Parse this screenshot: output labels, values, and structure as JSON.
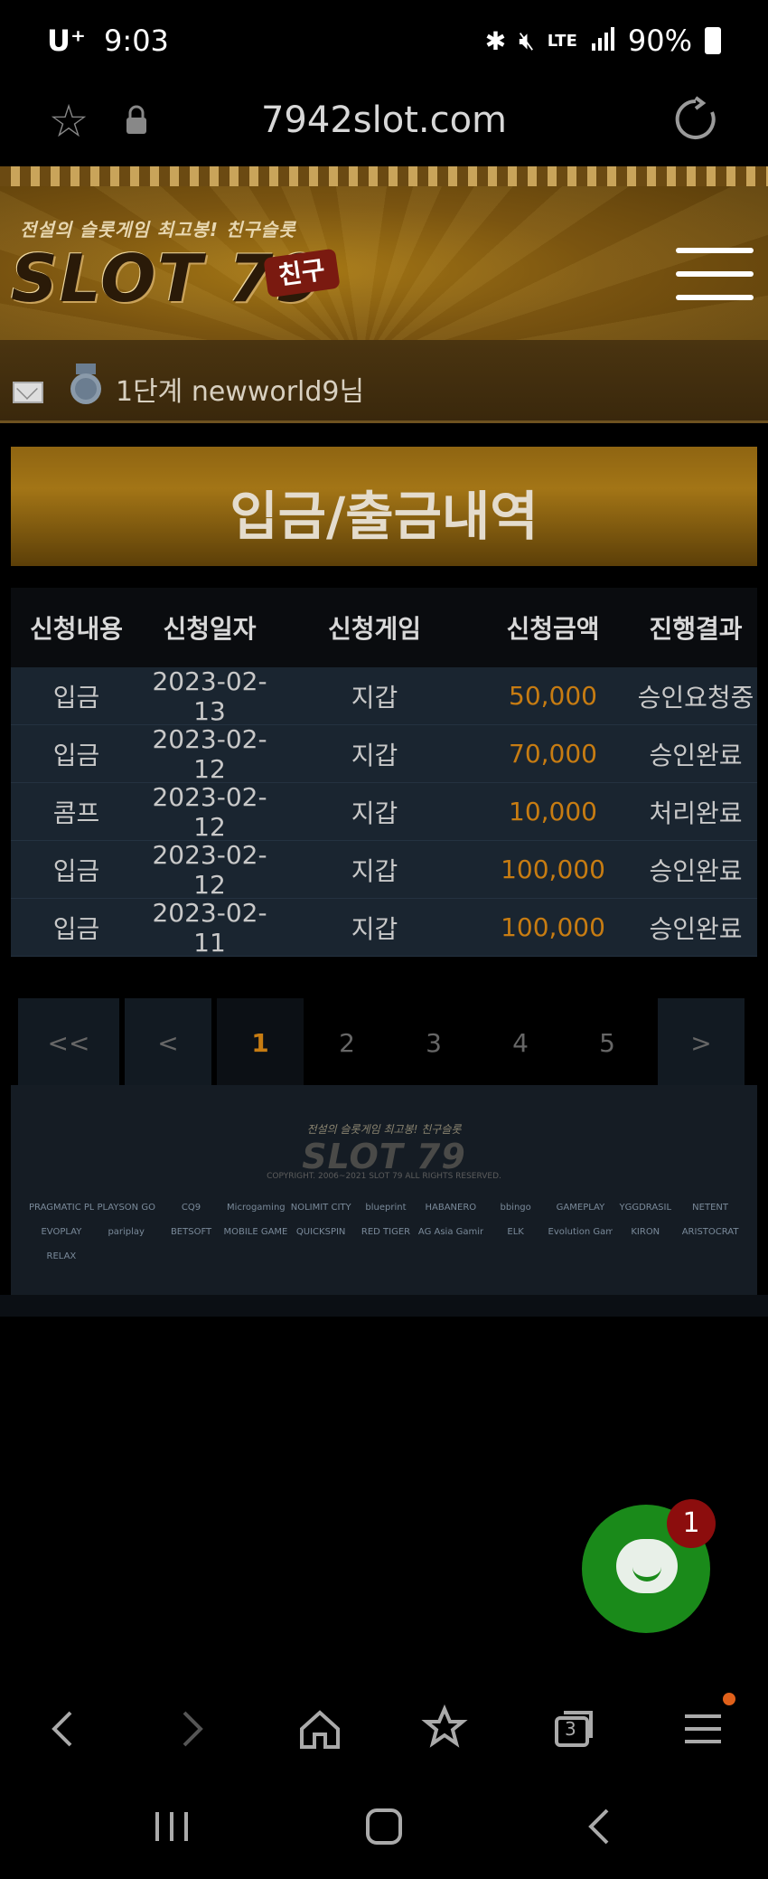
{
  "status_bar": {
    "carrier": "U⁺",
    "time": "9:03",
    "network": "LTE",
    "battery": "90%"
  },
  "browser": {
    "url": "7942slot.com"
  },
  "header": {
    "logo_tagline": "전설의 슬롯게임 최고봉! 친구슬롯",
    "logo_text": "SLOT 79",
    "logo_badge": "친구"
  },
  "user": {
    "greeting": "1단계 newworld9님"
  },
  "page_title": "입금/출금내역",
  "table": {
    "headers": [
      "신청내용",
      "신청일자",
      "신청게임",
      "신청금액",
      "진행결과"
    ],
    "rows": [
      {
        "type": "입금",
        "date": "2023-02-13",
        "game": "지갑",
        "amount": "50,000",
        "status": "승인요청중"
      },
      {
        "type": "입금",
        "date": "2023-02-12",
        "game": "지갑",
        "amount": "70,000",
        "status": "승인완료"
      },
      {
        "type": "콤프",
        "date": "2023-02-12",
        "game": "지갑",
        "amount": "10,000",
        "status": "처리완료"
      },
      {
        "type": "입금",
        "date": "2023-02-12",
        "game": "지갑",
        "amount": "100,000",
        "status": "승인완료"
      },
      {
        "type": "입금",
        "date": "2023-02-11",
        "game": "지갑",
        "amount": "100,000",
        "status": "승인완료"
      }
    ]
  },
  "pagination": {
    "first": "<<",
    "prev": "<",
    "pages": [
      "1",
      "2",
      "3",
      "4",
      "5"
    ],
    "next": ">",
    "current": "1"
  },
  "footer": {
    "tagline": "전설의 슬롯게임 최고봉! 친구슬롯",
    "logo_text": "SLOT 79",
    "copyright": "COPYRIGHT. 2006~2021 SLOT 79 ALL RIGHTS RESERVED.",
    "providers": [
      "PRAGMATIC PLAY",
      "PLAYSON GO",
      "CQ9",
      "Microgaming",
      "NOLIMIT CITY",
      "blueprint",
      "HABANERO",
      "bbingo",
      "GAMEPLAY",
      "YGGDRASIL",
      "NETENT",
      "EVOPLAY",
      "pariplay",
      "BETSOFT",
      "MOBILE GAMES",
      "QUICKSPIN",
      "RED TIGER",
      "AG Asia Gaming",
      "ELK",
      "Evolution Gaming",
      "KIRON",
      "ARISTOCRAT",
      "RELAX"
    ]
  },
  "chat": {
    "badge_count": "1"
  },
  "browser_nav": {
    "tab_count": "3"
  }
}
